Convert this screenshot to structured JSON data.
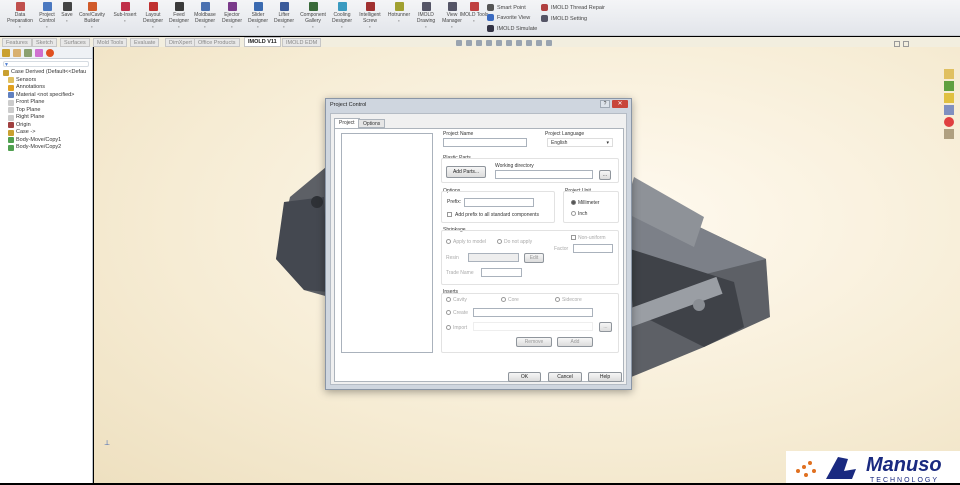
{
  "toolbar": {
    "items": [
      {
        "label": "Data Preparation",
        "icon": "data-preparation-icon",
        "color": "#c0504d"
      },
      {
        "label": "Project Control",
        "icon": "project-control-icon",
        "color": "#4a78c0"
      },
      {
        "label": "Save",
        "icon": "save-icon",
        "color": "#444"
      },
      {
        "label": "Core/Cavity Builder",
        "icon": "core-cavity-icon",
        "color": "#d05a2a"
      },
      {
        "label": "Sub-Insert",
        "icon": "sub-insert-icon",
        "color": "#c0304a"
      },
      {
        "label": "Layout Designer",
        "icon": "layout-designer-icon",
        "color": "#c03030"
      },
      {
        "label": "Feed Designer",
        "icon": "feed-designer-icon",
        "color": "#3a3a3a"
      },
      {
        "label": "Moldbase Designer",
        "icon": "moldbase-icon",
        "color": "#4a70b0"
      },
      {
        "label": "Ejector Designer",
        "icon": "ejector-icon",
        "color": "#7a3a8a"
      },
      {
        "label": "Slider Designer",
        "icon": "slider-icon",
        "color": "#3a6ab0"
      },
      {
        "label": "Lifter Designer",
        "icon": "lifter-icon",
        "color": "#3a5a9a"
      },
      {
        "label": "Component Gallery",
        "icon": "component-gallery-icon",
        "color": "#3a6a3a"
      },
      {
        "label": "Cooling Designer",
        "icon": "cooling-icon",
        "color": "#3a9ac0"
      },
      {
        "label": "Intelligent Screw",
        "icon": "screw-icon",
        "color": "#a03030"
      },
      {
        "label": "Hotrunner",
        "icon": "hotrunner-icon",
        "color": "#a0a030"
      },
      {
        "label": "IMOLD Drawing",
        "icon": "drawing-icon",
        "color": "#556"
      },
      {
        "label": "View Manager",
        "icon": "view-manager-icon",
        "color": "#556"
      },
      {
        "label": "IMOLD Tools",
        "icon": "tools-icon",
        "color": "#c04040"
      }
    ],
    "small": [
      {
        "label": "Smart Point",
        "icon": "smart-point-icon"
      },
      {
        "label": "Favorite View",
        "icon": "favorite-view-icon"
      },
      {
        "label": "IMOLD Simulate",
        "icon": "simulate-icon"
      },
      {
        "label": "IMOLD Thread Repair",
        "icon": "thread-repair-icon"
      },
      {
        "label": "IMOLD Setting",
        "icon": "setting-icon"
      }
    ]
  },
  "tabs": [
    "Features",
    "Sketch",
    "Surfaces",
    "Mold Tools",
    "Evaluate",
    "DimXpert",
    "Office Products",
    "IMOLD V11",
    "IMOLD EDM"
  ],
  "active_tab": "IMOLD V11",
  "tree": [
    {
      "label": "Case Derived  (Default<<Defau",
      "icon": "part-icon"
    },
    {
      "label": "Sensors",
      "icon": "sensors-icon"
    },
    {
      "label": "Annotations",
      "icon": "annotations-icon"
    },
    {
      "label": "Material <not specified>",
      "icon": "material-icon"
    },
    {
      "label": "Front Plane",
      "icon": "plane-icon"
    },
    {
      "label": "Top Plane",
      "icon": "plane-icon"
    },
    {
      "label": "Right Plane",
      "icon": "plane-icon"
    },
    {
      "label": "Origin",
      "icon": "origin-icon"
    },
    {
      "label": "Case ->",
      "icon": "part-icon"
    },
    {
      "label": "Body-Move/Copy1",
      "icon": "body-move-icon"
    },
    {
      "label": "Body-Move/Copy2",
      "icon": "body-move-icon"
    }
  ],
  "dialog": {
    "title": "Project Control",
    "tabs": [
      "Project",
      "Options"
    ],
    "project_name_label": "Project Name",
    "project_name_value": "",
    "language_label": "Project Language",
    "language_value": "English",
    "plastic_parts_label": "Plastic Parts",
    "add_parts": "Add Parts...",
    "working_dir_label": "Working directory",
    "browse": "...",
    "options_label": "Options",
    "prefix_label": "Prefix:",
    "add_prefix": "Add prefix to all standard components",
    "unit_label": "Project Unit",
    "unit_mm": "Millimeter",
    "unit_inch": "Inch",
    "shrinkage_label": "Shrinkage",
    "apply_model": "Apply to model",
    "do_not_apply": "Do not apply",
    "non_uniform": "Non-uniform",
    "factor": "Factor",
    "resin": "Resin",
    "edit": "Edit",
    "trade_name": "Trade Name",
    "inserts_label": "Inserts",
    "cavity": "Cavity",
    "core": "Core",
    "sidecore": "Sidecore",
    "create": "Create",
    "import": "Import",
    "remove": "Remove",
    "add": "Add",
    "ok": "OK",
    "cancel": "Cancel",
    "help": "Help"
  },
  "logo": {
    "text": "Manuso",
    "sub": "TECHNOLOGY"
  }
}
